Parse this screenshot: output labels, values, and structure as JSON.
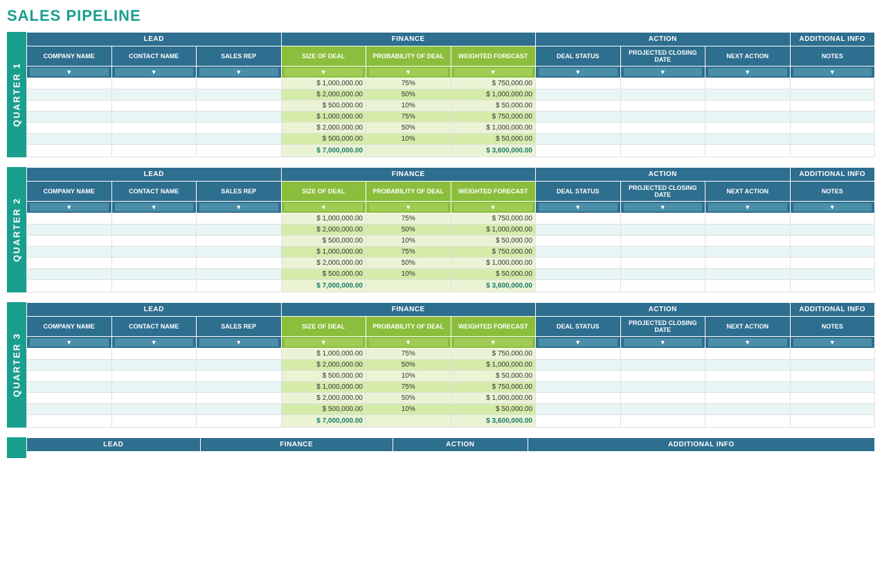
{
  "title": "SALES PIPELINE",
  "quarters": [
    {
      "label": "QUARTER 1",
      "rows": [
        {
          "size": "$ 1,000,000.00",
          "prob": "75%",
          "wf": "$ 750,000.00"
        },
        {
          "size": "$ 2,000,000.00",
          "prob": "50%",
          "wf": "$ 1,000,000.00"
        },
        {
          "size": "$ 500,000.00",
          "prob": "10%",
          "wf": "$ 50,000.00"
        },
        {
          "size": "$ 1,000,000.00",
          "prob": "75%",
          "wf": "$ 750,000.00"
        },
        {
          "size": "$ 2,000,000.00",
          "prob": "50%",
          "wf": "$ 1,000,000.00"
        },
        {
          "size": "$ 500,000.00",
          "prob": "10%",
          "wf": "$ 50,000.00"
        }
      ],
      "total_size": "$ 7,000,000.00",
      "total_wf": "$ 3,600,000.00"
    },
    {
      "label": "QUARTER 2",
      "rows": [
        {
          "size": "$ 1,000,000.00",
          "prob": "75%",
          "wf": "$ 750,000.00"
        },
        {
          "size": "$ 2,000,000.00",
          "prob": "50%",
          "wf": "$ 1,000,000.00"
        },
        {
          "size": "$ 500,000.00",
          "prob": "10%",
          "wf": "$ 50,000.00"
        },
        {
          "size": "$ 1,000,000.00",
          "prob": "75%",
          "wf": "$ 750,000.00"
        },
        {
          "size": "$ 2,000,000.00",
          "prob": "50%",
          "wf": "$ 1,000,000.00"
        },
        {
          "size": "$ 500,000.00",
          "prob": "10%",
          "wf": "$ 50,000.00"
        }
      ],
      "total_size": "$ 7,000,000.00",
      "total_wf": "$ 3,600,000.00"
    },
    {
      "label": "QUARTER 3",
      "rows": [
        {
          "size": "$ 1,000,000.00",
          "prob": "75%",
          "wf": "$ 750,000.00"
        },
        {
          "size": "$ 2,000,000.00",
          "prob": "50%",
          "wf": "$ 1,000,000.00"
        },
        {
          "size": "$ 500,000.00",
          "prob": "10%",
          "wf": "$ 50,000.00"
        },
        {
          "size": "$ 1,000,000.00",
          "prob": "75%",
          "wf": "$ 750,000.00"
        },
        {
          "size": "$ 2,000,000.00",
          "prob": "50%",
          "wf": "$ 1,000,000.00"
        },
        {
          "size": "$ 500,000.00",
          "prob": "10%",
          "wf": "$ 50,000.00"
        }
      ],
      "total_size": "$ 7,000,000.00",
      "total_wf": "$ 3,600,000.00"
    }
  ],
  "headers": {
    "lead": "LEAD",
    "finance": "FINANCE",
    "action": "ACTION",
    "additional_info": "ADDITIONAL INFO",
    "company_name": "COMPANY NAME",
    "contact_name": "CONTACT NAME",
    "sales_rep": "SALES REP",
    "size_of_deal": "SIZE OF DEAL",
    "probability_of_deal": "PROBABILITY OF DEAL",
    "weighted_forecast": "WEIGHTED FORECAST",
    "deal_status": "DEAL STATUS",
    "projected_closing_date": "PROJECTED CLOSING DATE",
    "next_action": "NEXT ACTION",
    "notes": "NOTES"
  }
}
